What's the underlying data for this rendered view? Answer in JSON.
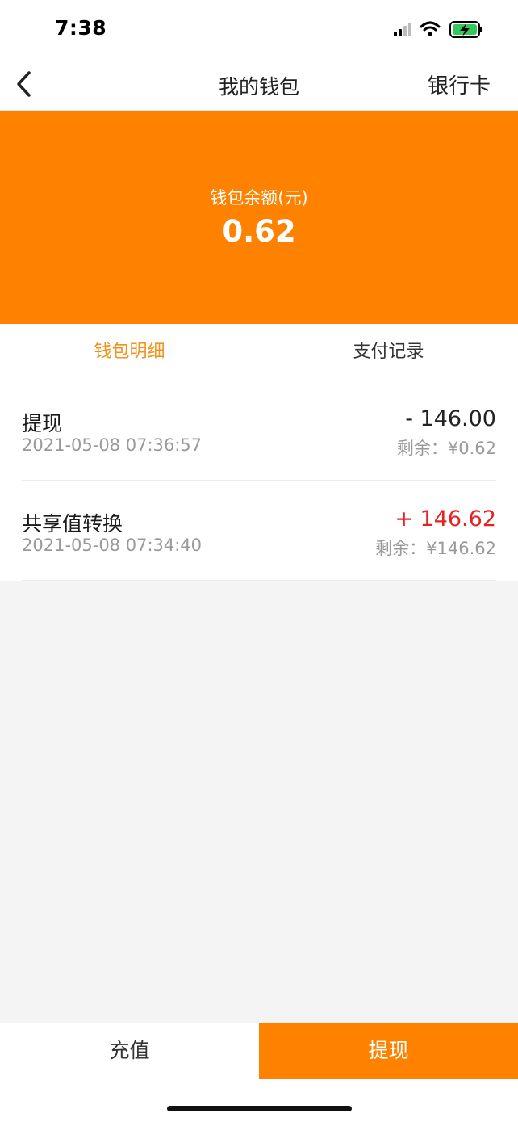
{
  "status_bar": {
    "time": "7:38",
    "icons": [
      "cellular-signal-icon",
      "wifi-icon",
      "battery-charging-icon"
    ]
  },
  "nav": {
    "back_icon": "chevron-left-icon",
    "title": "我的钱包",
    "right_label": "银行卡"
  },
  "balance": {
    "label": "钱包余额(元)",
    "value": "0.62",
    "background_color": "#fe8200"
  },
  "tabs": [
    {
      "label": "钱包明细",
      "active": true
    },
    {
      "label": "支付记录",
      "active": false
    }
  ],
  "transactions": [
    {
      "title": "提现",
      "time": "2021-05-08 07:36:57",
      "amount": "- 146.00",
      "remaining": "剩余：¥0.62"
    },
    {
      "title": "共享值转换",
      "time": "2021-05-08 07:34:40",
      "amount": "+ 146.62",
      "remaining": "剩余：¥146.62"
    }
  ],
  "bottom_bar": {
    "recharge_label": "充值",
    "withdraw_label": "提现"
  },
  "colors": {
    "accent": "#fe8200",
    "active_tab": "#f4921b",
    "positive_amount": "#e62323"
  }
}
